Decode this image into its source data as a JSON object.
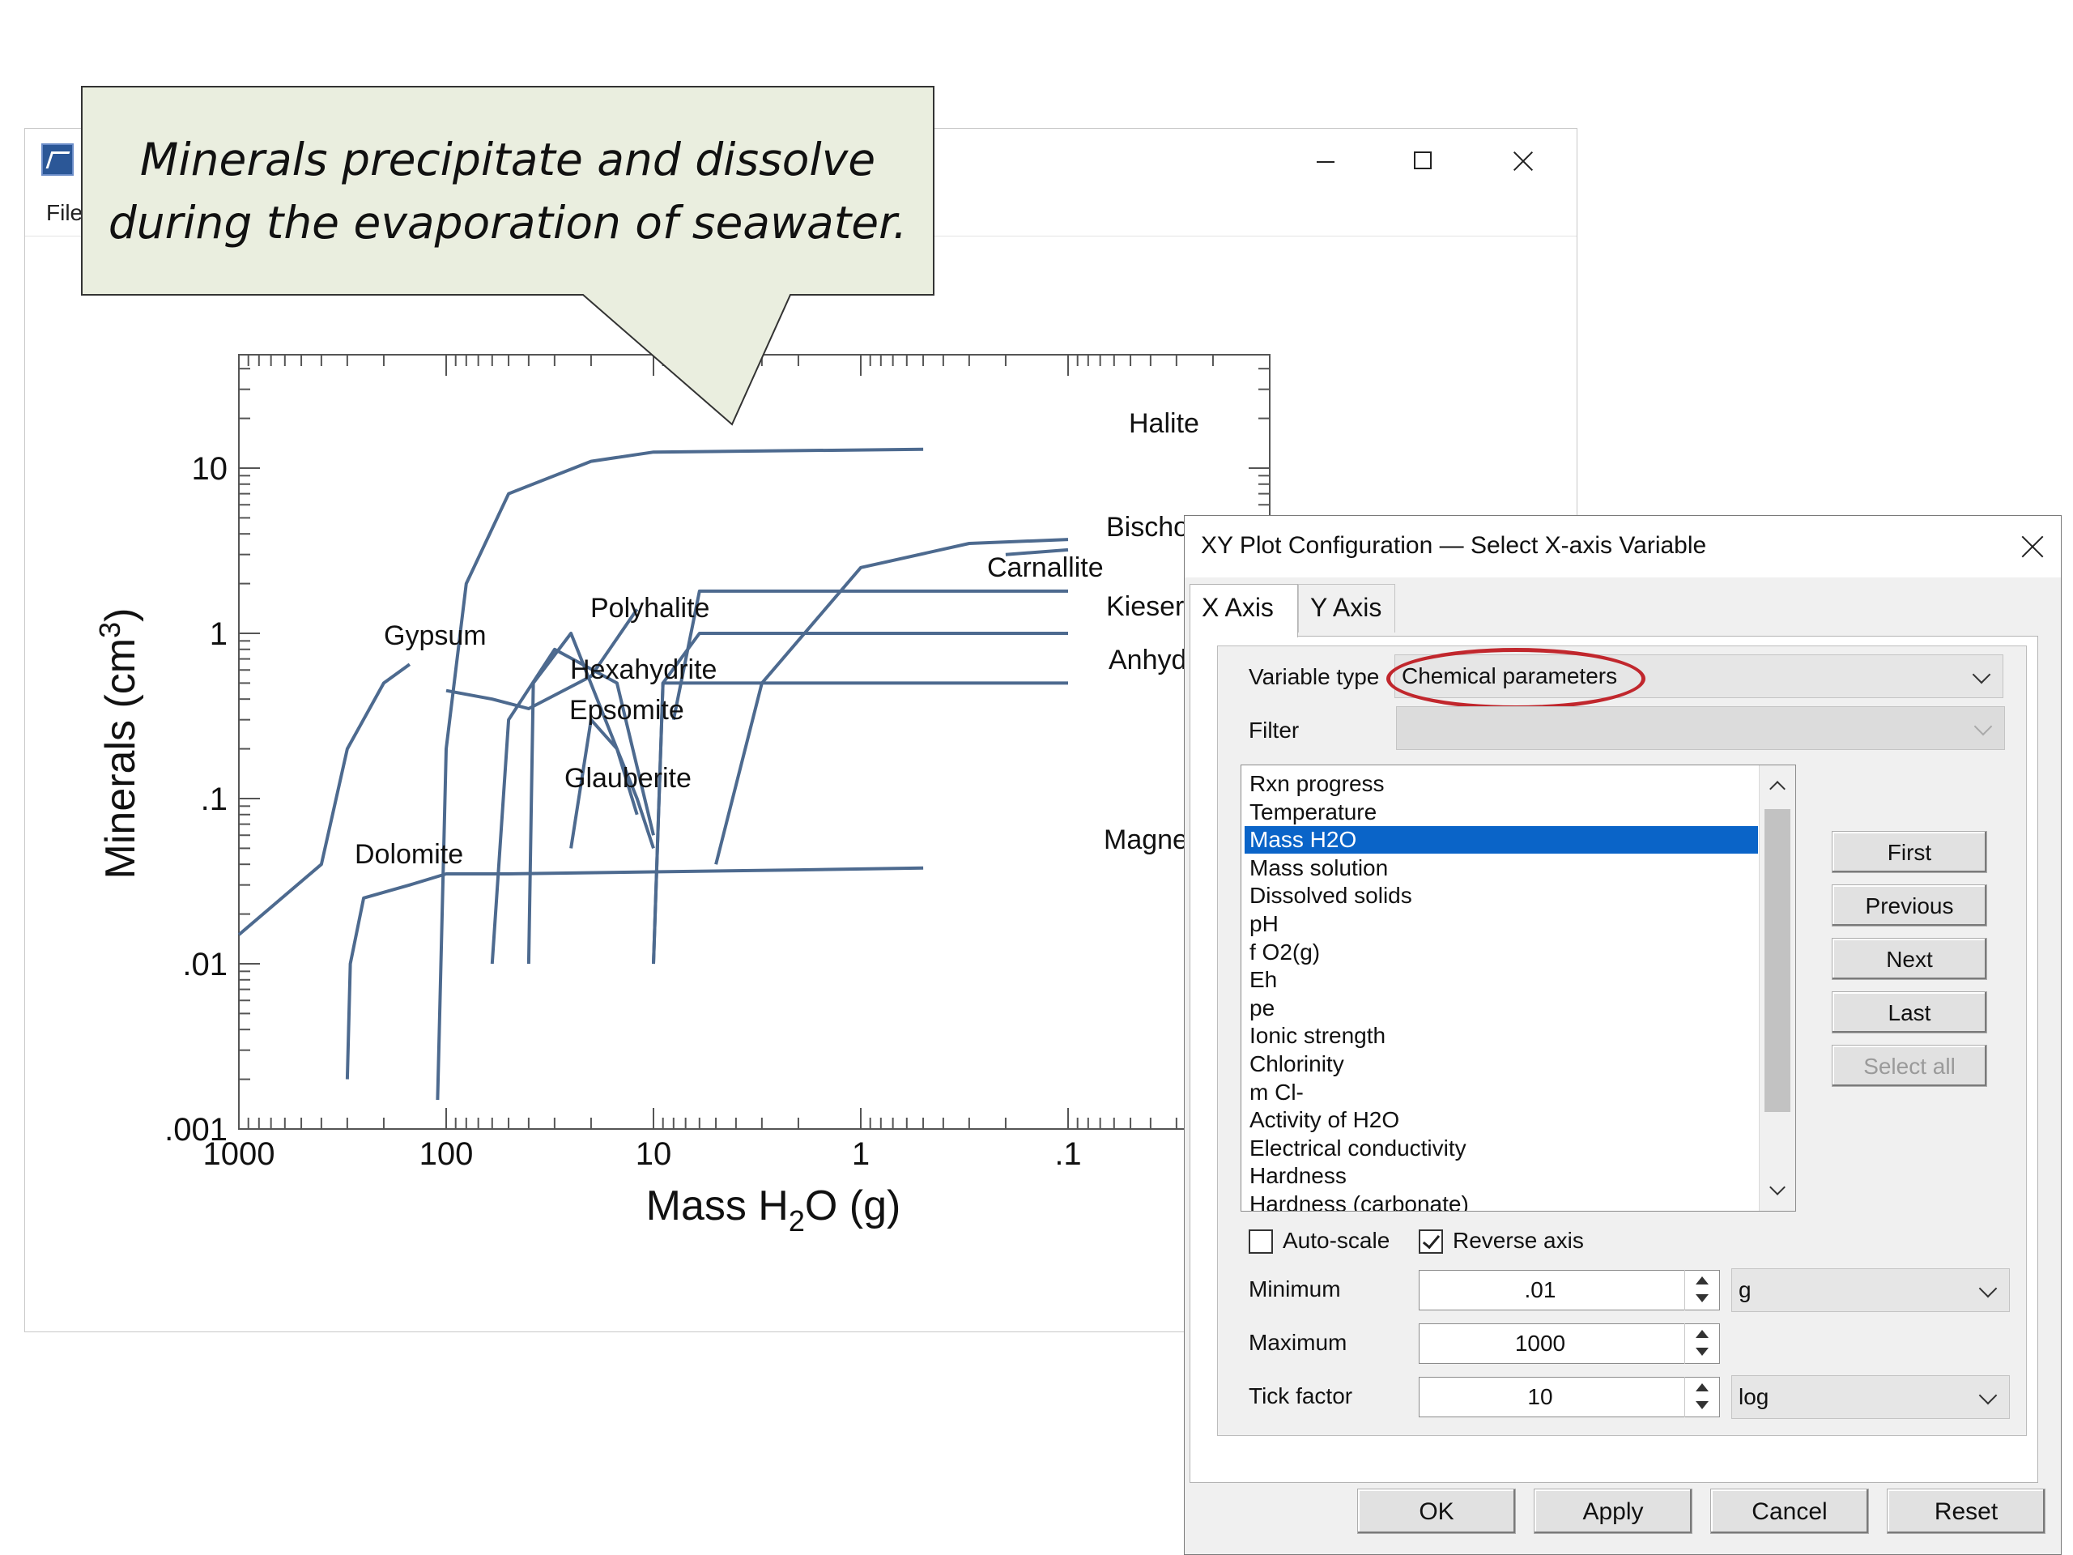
{
  "plot_window": {
    "menu_file": "File",
    "icon": "app-icon"
  },
  "callout": {
    "line1": "Minerals precipitate and dissolve",
    "line2": "during the evaporation of seawater."
  },
  "chart_data": {
    "type": "line",
    "xlabel": "Mass H2O (g)",
    "ylabel": "Minerals (cm3)",
    "x_scale": "log",
    "x_reversed": true,
    "xlim": [
      1000,
      0.01
    ],
    "ylim": [
      0.001,
      40
    ],
    "x_ticks": [
      "1000",
      "100",
      "10",
      "1",
      ".1"
    ],
    "y_ticks": [
      ".001",
      ".01",
      ".1",
      "1",
      "10"
    ],
    "series": [
      {
        "name": "Halite",
        "points": [
          [
            110,
            0.0015
          ],
          [
            100,
            0.2
          ],
          [
            80,
            2
          ],
          [
            50,
            7
          ],
          [
            20,
            11
          ],
          [
            10,
            12.5
          ],
          [
            0.5,
            13
          ]
        ]
      },
      {
        "name": "Gypsum",
        "points": [
          [
            1000,
            0.015
          ],
          [
            400,
            0.04
          ],
          [
            300,
            0.2
          ],
          [
            200,
            0.5
          ],
          [
            150,
            0.65
          ]
        ]
      },
      {
        "name": "Dolomite",
        "points": [
          [
            300,
            0.002
          ],
          [
            290,
            0.01
          ],
          [
            250,
            0.025
          ],
          [
            150,
            0.03
          ],
          [
            100,
            0.035
          ],
          [
            50,
            0.035
          ],
          [
            10,
            0.036
          ],
          [
            2,
            0.037
          ],
          [
            0.5,
            0.038
          ]
        ]
      },
      {
        "name": "Polyhalite",
        "points": [
          [
            60,
            0.01
          ],
          [
            50,
            0.3
          ],
          [
            30,
            0.8
          ],
          [
            15,
            0.5
          ],
          [
            10,
            0.06
          ]
        ]
      },
      {
        "name": "Hexahydrite",
        "points": [
          [
            100,
            0.45
          ],
          [
            60,
            0.4
          ],
          [
            40,
            0.35
          ],
          [
            20,
            0.55
          ],
          [
            12,
            1.4
          ]
        ]
      },
      {
        "name": "Epsomite",
        "points": [
          [
            25,
            0.05
          ],
          [
            20,
            0.3
          ],
          [
            15,
            0.2
          ],
          [
            12,
            0.1
          ],
          [
            10,
            0.05
          ]
        ]
      },
      {
        "name": "Glauberite",
        "points": [
          [
            40,
            0.01
          ],
          [
            38,
            0.5
          ],
          [
            25,
            1.0
          ],
          [
            15,
            0.2
          ],
          [
            12,
            0.08
          ]
        ]
      },
      {
        "name": "Carnallite",
        "points": [
          [
            5,
            0.04
          ],
          [
            3,
            0.5
          ],
          [
            1,
            2.5
          ],
          [
            0.3,
            3.5
          ],
          [
            0.1,
            3.7
          ]
        ]
      },
      {
        "name": "Bischofite",
        "points": [
          [
            0.2,
            3.0
          ],
          [
            0.1,
            3.2
          ]
        ]
      },
      {
        "name": "Kieserite",
        "points": [
          [
            8,
            0.3
          ],
          [
            6,
            1.8
          ],
          [
            0.1,
            1.8
          ]
        ]
      },
      {
        "name": "Anhydrite",
        "points": [
          [
            10,
            0.01
          ],
          [
            9,
            0.5
          ],
          [
            6,
            1.0
          ],
          [
            0.1,
            1.0
          ]
        ]
      },
      {
        "name": "Magnesite",
        "points": [
          [
            10,
            0.01
          ],
          [
            9,
            0.5
          ],
          [
            1,
            0.5
          ],
          [
            0.1,
            0.5
          ]
        ]
      }
    ],
    "labels": [
      "Halite",
      "Bischo",
      "Carnallite",
      "Kieser",
      "Anhyd",
      "Polyhalite",
      "Gypsum",
      "Hexahydrite",
      "Epsomite",
      "Glauberite",
      "Dolomite",
      "Magne"
    ]
  },
  "dialog": {
    "title": "XY Plot Configuration — Select X-axis Variable",
    "tabs": [
      "X Axis",
      "Y Axis"
    ],
    "variable_type_label": "Variable type",
    "variable_type_value": "Chemical parameters",
    "filter_label": "Filter",
    "filter_value": "",
    "list_items": [
      "Rxn progress",
      "Temperature",
      "Mass H2O",
      "Mass solution",
      "Dissolved solids",
      "pH",
      "f O2(g)",
      "Eh",
      "pe",
      "Ionic strength",
      "Chlorinity",
      "m Cl-",
      "Activity of H2O",
      "Electrical conductivity",
      "Hardness",
      "Hardness (carbonate)"
    ],
    "selected_item": "Mass H2O",
    "side_buttons": [
      "First",
      "Previous",
      "Next",
      "Last",
      "Select all"
    ],
    "autoscale_label": "Auto-scale",
    "autoscale_checked": false,
    "reverse_label": "Reverse axis",
    "reverse_checked": true,
    "minimum_label": "Minimum",
    "minimum_value": ".01",
    "minimum_unit": "g",
    "maximum_label": "Maximum",
    "maximum_value": "1000",
    "tick_label": "Tick factor",
    "tick_value": "10",
    "tick_scale": "log",
    "buttons": [
      "OK",
      "Apply",
      "Cancel",
      "Reset"
    ]
  },
  "colors": {
    "curve": "#4d6a8f",
    "callout_fill": "#eaeedf",
    "highlight": "#c1272d",
    "selection": "#0a64c8"
  }
}
